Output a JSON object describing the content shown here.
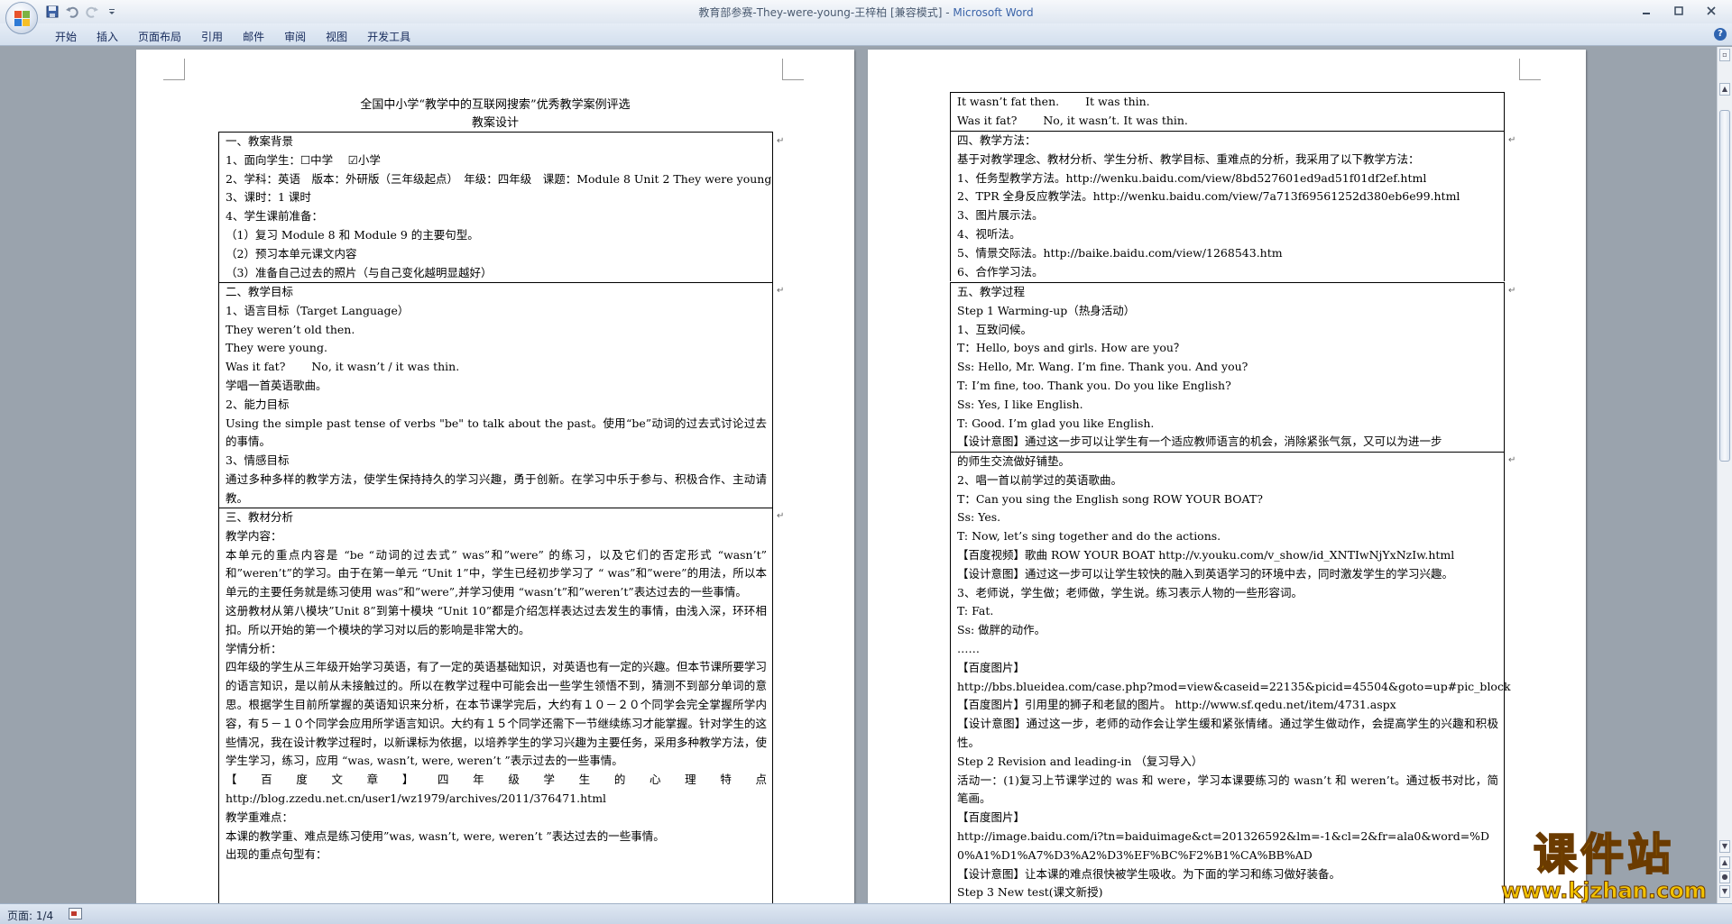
{
  "window": {
    "title": "教育部参赛-They-were-young-王梓柏 [兼容模式]",
    "separator": " - ",
    "app_name": "Microsoft Word"
  },
  "quick_access": [
    "save-icon",
    "undo-icon",
    "redo-icon",
    "customize-icon"
  ],
  "ribbon": {
    "tabs": [
      "开始",
      "插入",
      "页面布局",
      "引用",
      "邮件",
      "审阅",
      "视图",
      "开发工具"
    ]
  },
  "page1": {
    "title_line1": "全国中小学“教学中的互联网搜索”优秀教学案例评选",
    "title_line2": "教案设计",
    "sections": [
      {
        "lines": [
          "一、教案背景",
          "1、面向学生：☐中学　 ☑小学",
          "2、学科：英语　版本：外研版（三年级起点）　年级：四年级　课题：Module 8 Unit 2 They were young",
          "3、课时：1 课时",
          "4、学生课前准备：",
          "（1）复习 Module 8 和 Module 9 的主要句型。",
          "（2）预习本单元课文内容",
          "（3）准备自己过去的照片（与自己变化越明显越好）"
        ]
      },
      {
        "lines": [
          "二、教学目标",
          "1、语言目标（Target Language）",
          "They weren’t old then.",
          "They were young.",
          "Was it fat?　　 No, it wasn’t / it was thin.",
          "学唱一首英语歌曲。",
          "2、能力目标",
          "Using the simple past tense of verbs \"be\" to talk about the past。使用“be”动词的过去式讨论过去的事情。",
          "3、情感目标",
          "通过多种多样的教学方法，使学生保持持久的学习兴趣，勇于创新。在学习中乐于参与、积极合作、主动请教。"
        ]
      },
      {
        "lines": [
          "三、教材分析",
          "教学内容：",
          "本单元的重点内容是 “be “动词的过去式” was”和”were” 的练习，以及它们的否定形式 “wasn’t” 和”weren’t”的学习。由于在第一单元 “Unit 1”中，学生已经初步学习了 “ was”和”were”的用法，所以本单元的主要任务就是练习使用 was”和”were”,并学习使用 “wasn’t”和”weren’t”表达过去的一些事情。",
          "这册教材从第八模块”Unit 8”到第十模块 “Unit 10”都是介绍怎样表达过去发生的事情，由浅入深，环环相扣。所以开始的第一个模块的学习对以后的影响是非常大的。",
          "学情分析：",
          "四年级的学生从三年级开始学习英语，有了一定的英语基础知识，对英语也有一定的兴趣。但本节课所要学习的语言知识，是以前从未接触过的。所以在教学过程中可能会出一些学生领悟不到，猜测不到部分单词的意思。根据学生目前所掌握的英语知识来分析，在本节课学完后，大约有１０－２０个同学会完全掌握所学内容，有５－１０个同学会应用所学语言知识。大约有１５个同学还需下一节继续练习才能掌握。针对学生的这些情况，我在设计教学过程时，以新课标为依据，以培养学生的学习兴趣为主要任务，采用多种教学方法，使学生学习，练习，应用 “was, wasn’t, were, weren’t ”表示过去的一些事情。",
          "【百度文章】四年级学生的心理特点 http://blog.zzedu.net.cn/user1/wz1979/archives/2011/376471.html",
          "教学重难点：",
          "本课的教学重、难点是练习使用”was, wasn’t, were, weren’t ”表达过去的一些事情。",
          "出现的重点句型有："
        ]
      }
    ]
  },
  "page2": {
    "sections": [
      {
        "lines": [
          "It wasn’t fat then.　　 It was thin.",
          "Was it fat?　　 No, it wasn’t. It was thin."
        ]
      },
      {
        "lines": [
          "四、教学方法：",
          "基于对教学理念、教材分析、学生分析、教学目标、重难点的分析，我采用了以下教学方法：",
          "1、任务型教学方法。http://wenku.baidu.com/view/8bd527601ed9ad51f01df2ef.html",
          "2、TPR 全身反应教学法。http://wenku.baidu.com/view/7a713f69561252d380eb6e99.html",
          "3、图片展示法。",
          "4、视听法。",
          "5、情景交际法。http://baike.baidu.com/view/1268543.htm",
          "6、合作学习法。"
        ]
      },
      {
        "lines": [
          "五、教学过程",
          "Step 1 Warming-up（热身活动）",
          "1、互致问候。",
          "T：Hello, boys and girls. How are you？",
          "Ss: Hello, Mr. Wang. I’m fine. Thank you. And you?",
          "T: I’m fine, too. Thank you. Do you like English?",
          "Ss: Yes, I like English.",
          "T: Good. I’m glad you like English.",
          "【设计意图】通过这一步可以让学生有一个适应教师语言的机会，消除紧张气氛，又可以为进一步"
        ]
      },
      {
        "lines": [
          "的师生交流做好铺垫。",
          "2、唱一首以前学过的英语歌曲。",
          "T：Can you sing the English song ROW YOUR BOAT?",
          "Ss: Yes.",
          "T: Now, let’s sing together and do the actions.",
          "【百度视频】歌曲 ROW YOUR BOAT http://v.youku.com/v_show/id_XNTIwNjYxNzIw.html",
          "【设计意图】通过这一步可以让学生较快的融入到英语学习的环境中去，同时激发学生的学习兴趣。",
          "3、老师说，学生做；老师做，学生说。练习表示人物的一些形容词。",
          "T: Fat.",
          "Ss: 做胖的动作。",
          "……",
          "【百度图片】",
          "http://bbs.blueidea.com/case.php?mod=view&caseid=22135&picid=45504&goto=up#pic_block",
          "【百度图片】引用里的狮子和老鼠的图片。 http://www.sf.qedu.net/item/4731.aspx",
          "【设计意图】通过这一步，老师的动作会让学生缓和紧张情绪。通过学生做动作，会提高学生的兴趣和积极性。",
          "Step 2 Revision and leading-in （复习导入）",
          "活动一：(1)复习上节课学过的 was 和 were，学习本课要练习的 wasn’t 和 weren’t。通过板书对比，简笔画。",
          "【百度图片】",
          "http://image.baidu.com/i?tn=baiduimage&ct=201326592&lm=-1&cl=2&fr=ala0&word=%D0%A1%D1%A7%D3%A2%D3%EF%BC%F2%B1%CA%BB%AD",
          "【设计意图】让本课的难点很快被学生吸收。为下面的学习和练习做好装备。",
          "Step 3 New test(课文新授)"
        ]
      }
    ]
  },
  "status": {
    "page_count": "页面: 1/4"
  },
  "watermark": {
    "cn": "课件站",
    "url": "www.kjzhan.com"
  },
  "colors": {
    "background": "#9aa3ad",
    "ribbon": "#d3dfee",
    "page": "#ffffff",
    "app_name": "#3a63a8",
    "watermark": "#f2c200"
  }
}
